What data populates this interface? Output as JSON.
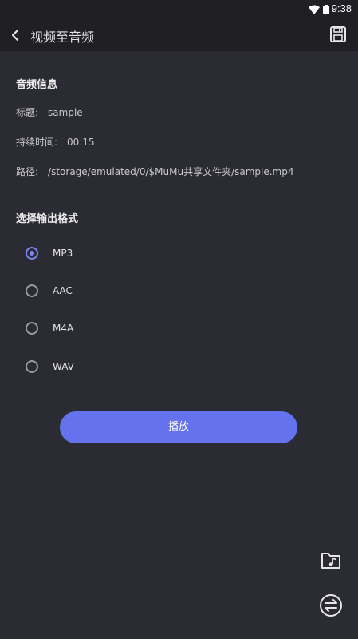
{
  "status_bar": {
    "time": "9:38",
    "icons": [
      "wifi-icon",
      "battery-icon"
    ]
  },
  "app_bar": {
    "back_icon": "chevron-left-icon",
    "title": "视频至音频",
    "save_icon": "save-floppy-icon"
  },
  "audio_info": {
    "section_title": "音频信息",
    "title_label": "标题:",
    "title_value": "sample",
    "duration_label": "持续时间:",
    "duration_value": "00:15",
    "path_label": "路径:",
    "path_value": "/storage/emulated/0/$MuMu共享文件夹/sample.mp4"
  },
  "output_format": {
    "section_title": "选择输出格式",
    "options": [
      {
        "label": "MP3",
        "selected": true
      },
      {
        "label": "AAC",
        "selected": false
      },
      {
        "label": "M4A",
        "selected": false
      },
      {
        "label": "WAV",
        "selected": false
      }
    ]
  },
  "actions": {
    "play_label": "播放",
    "music_folder_icon": "music-folder-icon",
    "convert_icon": "swap-arrows-icon"
  },
  "colors": {
    "background": "#2b2c33",
    "app_bar": "#1f1f24",
    "accent": "#6472ee",
    "radio_selected": "#7a85f2"
  }
}
